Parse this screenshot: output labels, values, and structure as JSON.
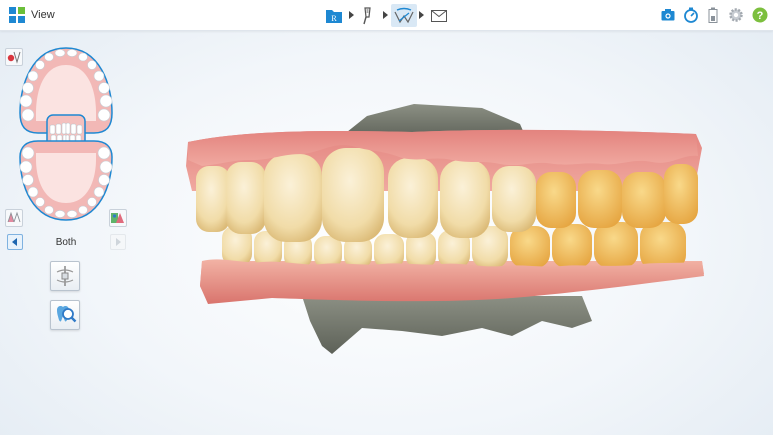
{
  "header": {
    "app_title": "View",
    "app_icon": "grid-icon",
    "workflow_steps": [
      {
        "icon": "rx-icon",
        "label": "R"
      },
      {
        "icon": "scan-wand-icon"
      },
      {
        "icon": "view-model-icon",
        "active": true
      },
      {
        "icon": "mail-icon"
      }
    ],
    "tray_icons": [
      "camera-icon",
      "timer-icon",
      "battery-icon",
      "settings-icon",
      "help-icon"
    ],
    "help_glyph": "?"
  },
  "left_panel": {
    "jaw_selector": "both-jaws-diagram",
    "jaw_label": "Both",
    "tools": [
      "segment-tool-icon",
      "tooth-inspect-icon"
    ]
  },
  "colors": {
    "accent": "#1e88d2",
    "help_green": "#7cbf3e",
    "gum": "#e8a29b",
    "tooth": "#f3e3c3",
    "base": "#6f7368"
  }
}
